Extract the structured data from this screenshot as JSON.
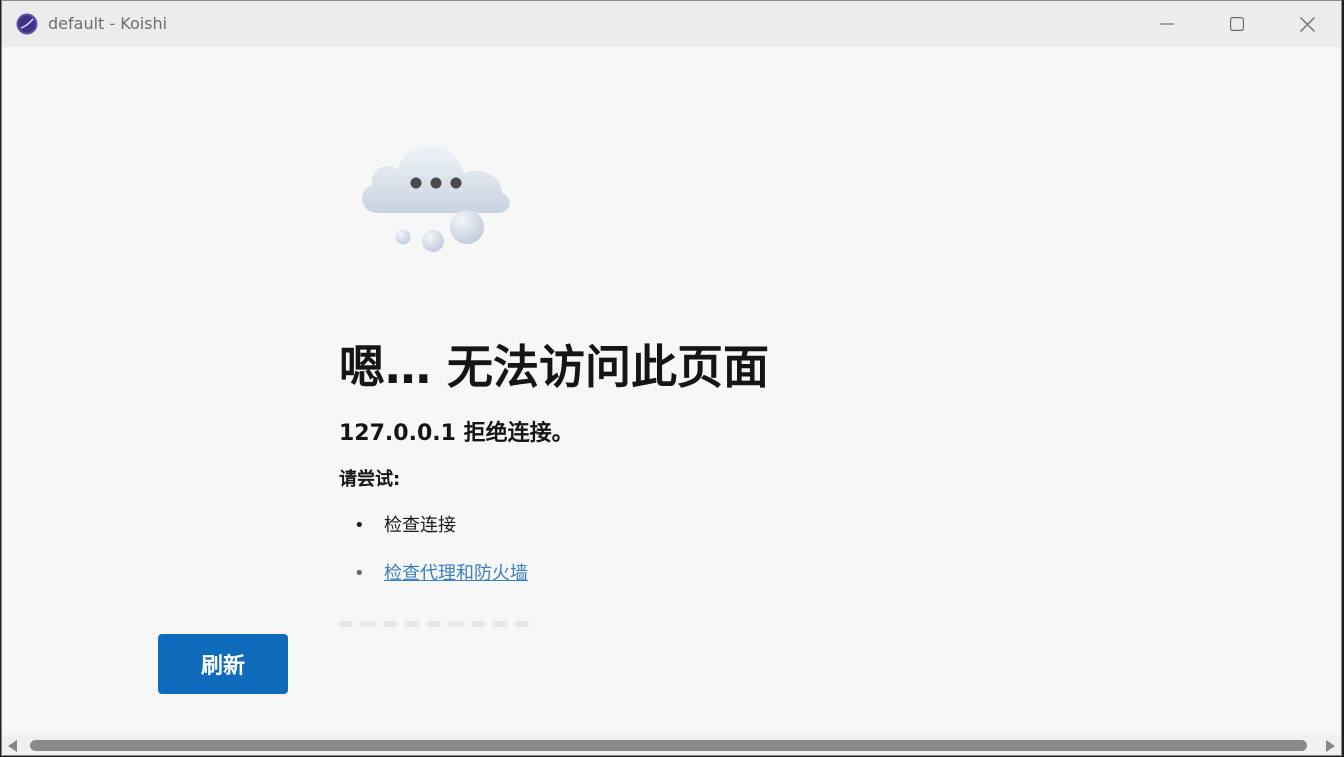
{
  "window": {
    "title": "default - Koishi",
    "app_icon": "koishi-moon-icon",
    "controls": {
      "minimize_icon": "minimize-icon",
      "maximize_icon": "maximize-icon",
      "close_icon": "close-icon"
    }
  },
  "error_page": {
    "illustration": "cloud-thinking-icon",
    "heading": "嗯… 无法访问此页面",
    "subheading": "127.0.0.1 拒绝连接。",
    "try_label": "请尝试:",
    "suggestions": [
      {
        "text": "检查连接",
        "is_link": false
      },
      {
        "text": "检查代理和防火墙",
        "is_link": true
      }
    ],
    "refresh_button": "刷新"
  },
  "colors": {
    "accent": "#0f6cbd",
    "link": "#3a7fc1",
    "page_bg": "#f7f7f7",
    "titlebar_bg": "#ececec"
  }
}
